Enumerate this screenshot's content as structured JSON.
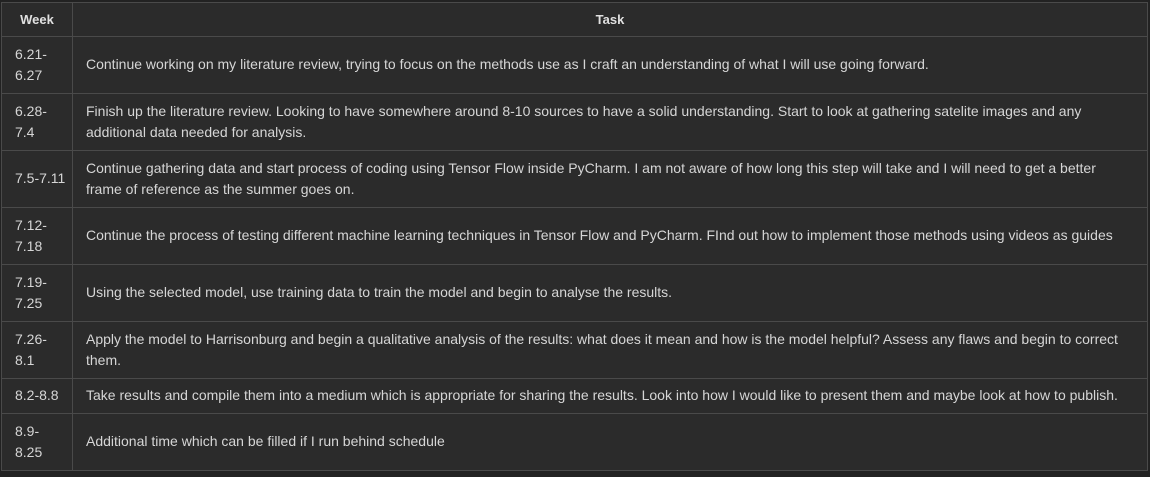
{
  "table": {
    "headers": [
      "Week",
      "Task"
    ],
    "rows": [
      {
        "week": "6.21-6.27",
        "task": "Continue working on my literature review, trying to focus on the methods use as I craft an understanding of what I will use going forward."
      },
      {
        "week": "6.28-7.4",
        "task": "Finish up the literature review. Looking to have somewhere around 8-10 sources to have a solid understanding. Start to look at gathering satelite images and any additional data needed for analysis."
      },
      {
        "week": "7.5-7.11",
        "task": "Continue gathering data and start process of coding using Tensor Flow inside PyCharm. I am not aware of how long this step will take and I will need to get a better frame of reference as the summer goes on."
      },
      {
        "week": "7.12-7.18",
        "task": "Continue the process of testing different machine learning techniques in Tensor Flow and PyCharm. FInd out how to implement those methods using videos as guides"
      },
      {
        "week": "7.19-7.25",
        "task": "Using the selected model, use training data to train the model and begin to analyse the results."
      },
      {
        "week": "7.26-8.1",
        "task": "Apply the model to Harrisonburg and begin a qualitative analysis of the results: what does it mean and how is the model helpful? Assess any flaws and begin to correct them."
      },
      {
        "week": "8.2-8.8",
        "task": "Take results and compile them into a medium which is appropriate for sharing the results. Look into how I would like to present them and maybe look at how to publish."
      },
      {
        "week": "8.9-8.25",
        "task": "Additional time which can be filled if I run behind schedule"
      }
    ]
  }
}
